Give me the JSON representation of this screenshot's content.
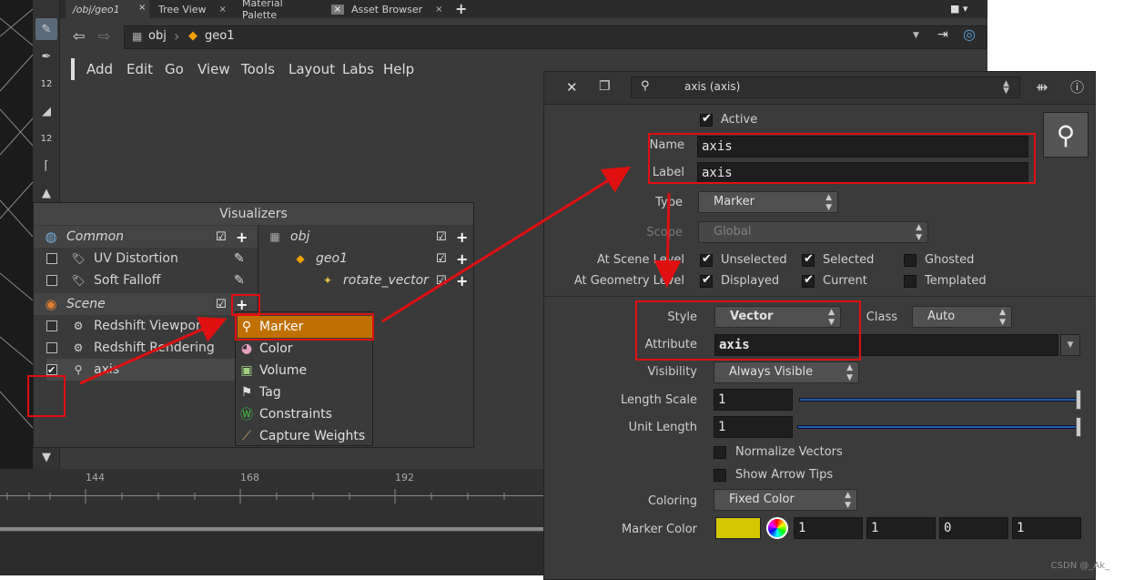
{
  "tabs": [
    {
      "label": "/obj/geo1",
      "current": true
    },
    {
      "label": "Tree View"
    },
    {
      "label": "Material Palette"
    },
    {
      "label": "Asset Browser"
    }
  ],
  "tab_close": "×",
  "tab_add": "+",
  "path": {
    "obj": "obj",
    "geo": "geo1"
  },
  "menu": [
    "Add",
    "Edit",
    "Go",
    "View",
    "Tools",
    "Layout",
    "Labs",
    "Help"
  ],
  "left_tools": [
    "12",
    "12"
  ],
  "visualizers": {
    "title": "Visualizers",
    "common": "Common",
    "common_items": [
      "UV Distortion",
      "Soft Falloff"
    ],
    "scene": "Scene",
    "scene_items": [
      "Redshift Viewport...",
      "Redshift Rendering",
      "axis"
    ],
    "tree": {
      "obj": "obj",
      "geo": "geo1",
      "node": "rotate_vector"
    }
  },
  "popup": [
    "Marker",
    "Color",
    "Volume",
    "Tag",
    "Constraints",
    "Capture Weights"
  ],
  "timeline": {
    "ticks": [
      "144",
      "168",
      "192"
    ]
  },
  "param": {
    "title": "axis (axis)",
    "active": "Active",
    "name_label": "Name",
    "name_value": "axis",
    "label_label": "Label",
    "label_value": "axis",
    "type_label": "Type",
    "type_value": "Marker",
    "scope_label": "Scope",
    "scope_value": "Global",
    "scene_level_label": "At Scene Level",
    "geometry_level_label": "At Geometry Level",
    "unselected": "Unselected",
    "selected": "Selected",
    "ghosted": "Ghosted",
    "displayed": "Displayed",
    "current": "Current",
    "templated": "Templated",
    "style_label": "Style",
    "style_value": "Vector",
    "class_label": "Class",
    "class_value": "Auto",
    "attribute_label": "Attribute",
    "attribute_value": "axis",
    "visibility_label": "Visibility",
    "visibility_value": "Always Visible",
    "length_scale_label": "Length Scale",
    "length_scale_value": "1",
    "unit_length_label": "Unit Length",
    "unit_length_value": "1",
    "normalize_label": "Normalize Vectors",
    "arrow_tips_label": "Show Arrow Tips",
    "coloring_label": "Coloring",
    "coloring_value": "Fixed Color",
    "marker_color_label": "Marker Color",
    "marker_color_values": [
      "1",
      "1",
      "0",
      "1"
    ],
    "marker_color_hex": "#d4c800"
  },
  "watermark": "CSDN @_Ak_",
  "colors": {
    "annotation": "#e01010",
    "highlight": "#c07000"
  }
}
